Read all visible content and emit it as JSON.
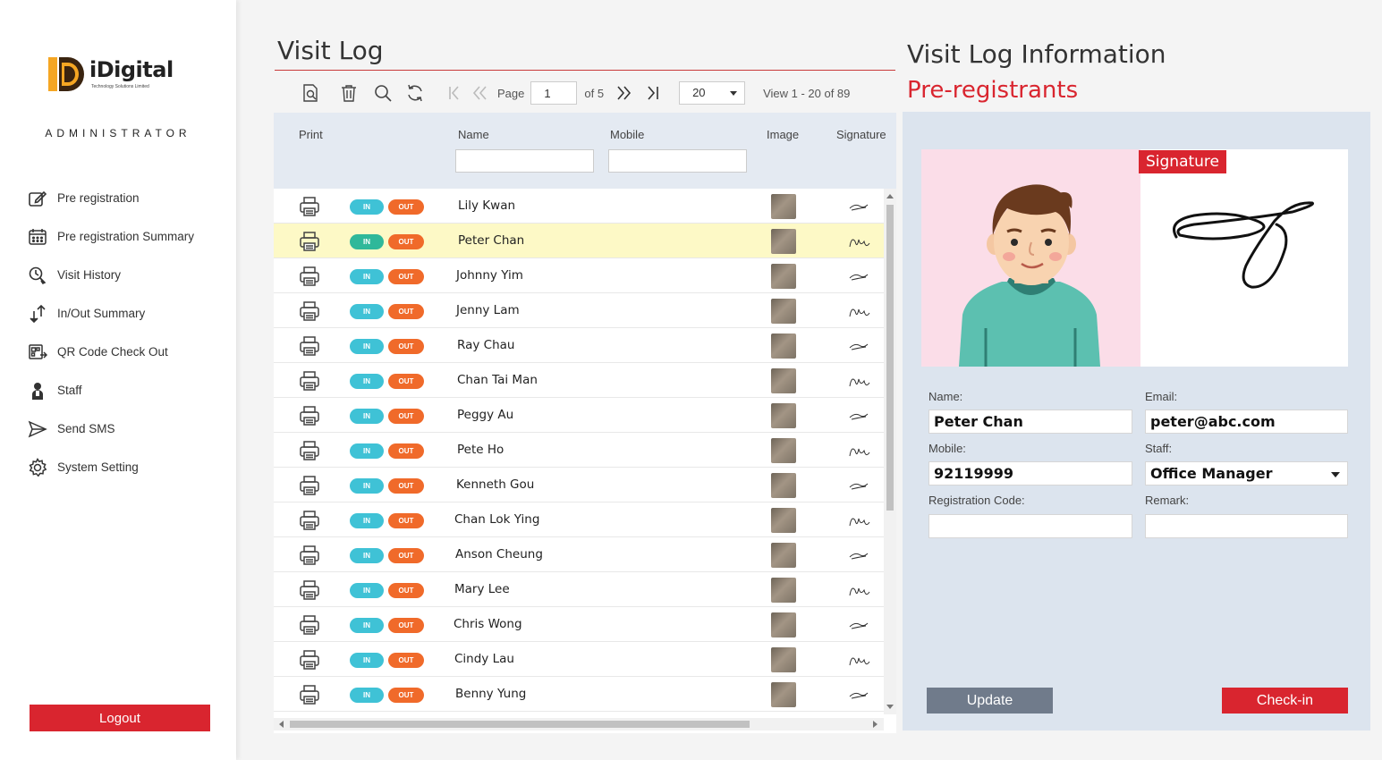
{
  "brand": {
    "logo_text": "iDigital",
    "logo_sub": "Technology Solutions Limited",
    "role": "ADMINISTRATOR"
  },
  "nav": {
    "items": [
      {
        "label": "Pre registration",
        "icon": "edit-icon"
      },
      {
        "label": "Pre registration Summary",
        "icon": "calendar-icon"
      },
      {
        "label": "Visit History",
        "icon": "history-search-icon"
      },
      {
        "label": "In/Out Summary",
        "icon": "in-out-arrows-icon"
      },
      {
        "label": "QR Code Check Out",
        "icon": "qr-checkout-icon"
      },
      {
        "label": "Staff",
        "icon": "staff-icon"
      },
      {
        "label": "Send SMS",
        "icon": "send-icon"
      },
      {
        "label": "System Setting",
        "icon": "gear-icon"
      }
    ],
    "logout_label": "Logout"
  },
  "visit_log": {
    "title": "Visit Log",
    "pager": {
      "page_label": "Page",
      "page_value": "1",
      "of_label": "of 5",
      "page_size": "20",
      "view_text": "View 1 - 20 of 89"
    },
    "columns": {
      "print": "Print",
      "name": "Name",
      "mobile": "Mobile",
      "image": "Image",
      "signature": "Signature"
    },
    "in_label": "IN",
    "out_label": "OUT",
    "rows": [
      "Lily Kwan",
      "Peter Chan",
      "Johnny Yim",
      "Jenny Lam",
      "Ray Chau",
      "Chan Tai Man",
      "Peggy Au",
      "Pete Ho",
      "Kenneth Gou",
      "Chan Lok Ying",
      "Anson Cheung",
      "Mary Lee",
      "Chris Wong",
      "Cindy Lau",
      "Benny Yung"
    ],
    "selected_row": 1
  },
  "info": {
    "title": "Visit Log Information",
    "subtitle": "Pre-registrants",
    "signature_label": "Signature",
    "fields": {
      "name_label": "Name:",
      "name_value": "Peter Chan",
      "email_label": "Email:",
      "email_value": "peter@abc.com",
      "mobile_label": "Mobile:",
      "mobile_value": "92119999",
      "staff_label": "Staff:",
      "staff_value": "Office Manager",
      "regcode_label": "Registration Code:",
      "regcode_value": "",
      "remark_label": "Remark:",
      "remark_value": ""
    },
    "update_label": "Update",
    "checkin_label": "Check-in"
  },
  "colors": {
    "accent_red": "#d9252f",
    "in_pill": "#3fc2d6",
    "out_pill": "#f06a2a",
    "selected_row": "#fdf9c6",
    "panel_bg": "#dce4ee"
  }
}
